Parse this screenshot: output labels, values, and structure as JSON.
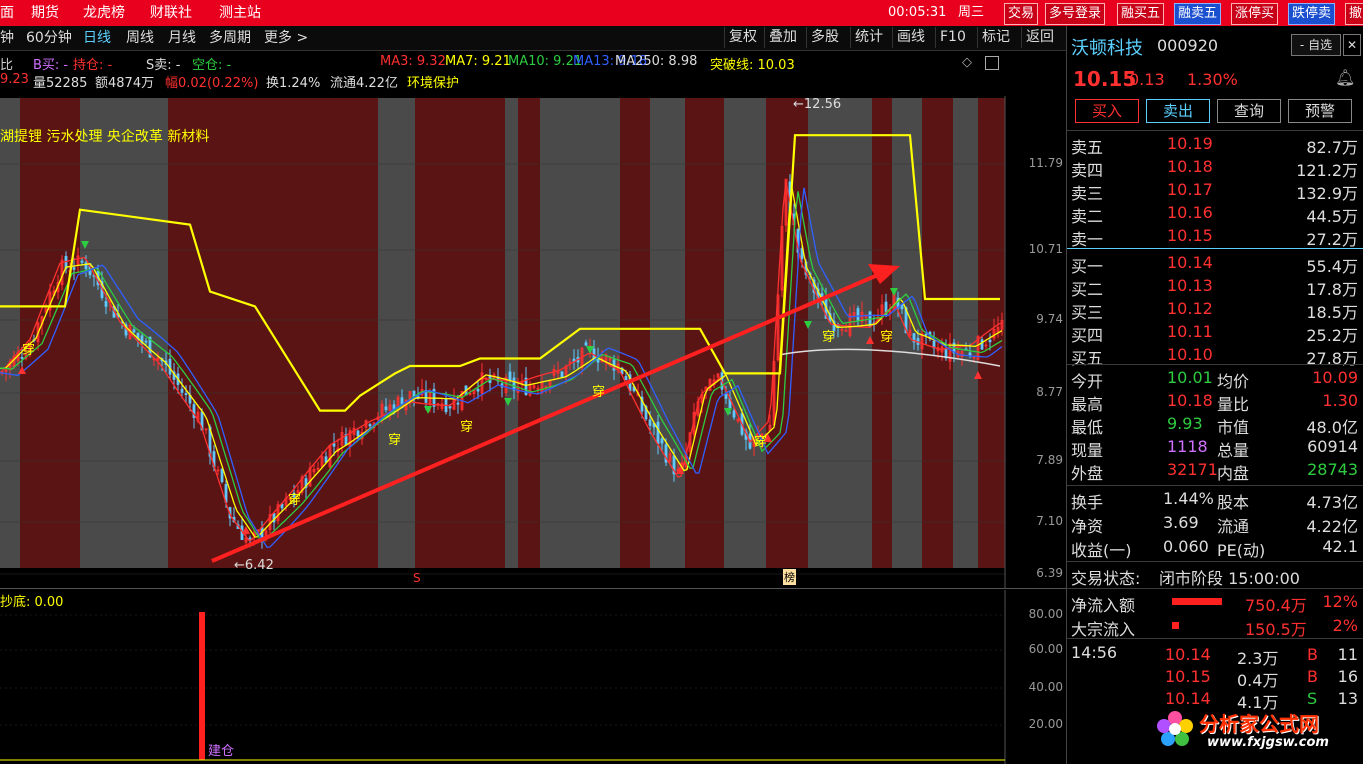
{
  "menu": {
    "items": [
      "面",
      "期货",
      "龙虎榜",
      "财联社",
      "测主站"
    ],
    "time": "00:05:31",
    "weekday": "周三",
    "buttons": [
      "交易",
      "多号登录",
      "融买五",
      "融卖五",
      "涨停买",
      "跌停卖",
      "撤"
    ]
  },
  "toolbar": {
    "timeframes": [
      "钟",
      "60分钟",
      "日线",
      "周线",
      "月线",
      "多周期",
      "更多 >"
    ],
    "active": "日线",
    "buttons": [
      "复权",
      "叠加",
      "多股",
      "统计",
      "画线",
      "F10",
      "标记",
      "返回"
    ]
  },
  "indicators": {
    "row1": [
      {
        "t": "比",
        "c": "#ccc"
      },
      {
        "t": "B买: -",
        "c": "#d070ff"
      },
      {
        "t": "持仓: -",
        "c": "#ff3030"
      },
      {
        "t": "S卖: -",
        "c": "#ddd"
      },
      {
        "t": "空仓: -",
        "c": "#2ecc40"
      },
      {
        "t": "MA3: 9.32",
        "c": "#ff3030"
      },
      {
        "t": "MA7: 9.21",
        "c": "#ffff00"
      },
      {
        "t": "MA10: 9.21",
        "c": "#2ecc40"
      },
      {
        "t": "MA13: 9.18",
        "c": "#3060ff"
      },
      {
        "t": "MA250: 8.98",
        "c": "#ddd"
      },
      {
        "t": "突破线: 10.03",
        "c": "#ffff00"
      }
    ],
    "row2": [
      {
        "t": "9.23",
        "c": "#ff3030"
      },
      {
        "t": "量52285",
        "c": "#ddd"
      },
      {
        "t": "额4874万",
        "c": "#ddd"
      },
      {
        "t": "幅0.02(0.22%)",
        "c": "#ff3030"
      },
      {
        "t": "换1.24%",
        "c": "#ddd"
      },
      {
        "t": "流通4.22亿",
        "c": "#ddd"
      },
      {
        "t": "环境保护",
        "c": "#ffff00"
      }
    ]
  },
  "concepts": "湖提锂 污水处理 央企改革 新材料",
  "annotations": {
    "high": "12.56",
    "low": "6.42",
    "cross": "穿",
    "marker_s": "S",
    "marker_bang": "榜",
    "build": "建仓",
    "sub_title": "抄底: 0.00"
  },
  "price_axis": [
    "11.79",
    "10.71",
    "9.74",
    "8.77",
    "7.89",
    "7.10",
    "6.39"
  ],
  "sub_axis": [
    "80.00",
    "60.00",
    "40.00",
    "20.00"
  ],
  "stock": {
    "name": "沃顿科技",
    "code": "000920",
    "price": "10.15",
    "change": "0.13",
    "pct": "1.30%",
    "watch_btn": "- 自选"
  },
  "actions": [
    "买入",
    "卖出",
    "查询",
    "预警"
  ],
  "orderbook": {
    "asks": [
      {
        "l": "卖五",
        "p": "10.19",
        "v": "82.7万"
      },
      {
        "l": "卖四",
        "p": "10.18",
        "v": "121.2万"
      },
      {
        "l": "卖三",
        "p": "10.17",
        "v": "132.9万"
      },
      {
        "l": "卖二",
        "p": "10.16",
        "v": "44.5万"
      },
      {
        "l": "卖一",
        "p": "10.15",
        "v": "27.2万"
      }
    ],
    "bids": [
      {
        "l": "买一",
        "p": "10.14",
        "v": "55.4万"
      },
      {
        "l": "买二",
        "p": "10.13",
        "v": "17.8万"
      },
      {
        "l": "买三",
        "p": "10.12",
        "v": "18.5万"
      },
      {
        "l": "买四",
        "p": "10.11",
        "v": "25.2万"
      },
      {
        "l": "买五",
        "p": "10.10",
        "v": "27.8万"
      }
    ]
  },
  "quote": [
    {
      "l1": "今开",
      "v1": "10.01",
      "c1": "#2ecc40",
      "l2": "均价",
      "v2": "10.09",
      "c2": "#ff3030"
    },
    {
      "l1": "最高",
      "v1": "10.18",
      "c1": "#ff3030",
      "l2": "量比",
      "v2": "1.30",
      "c2": "#ff3030"
    },
    {
      "l1": "最低",
      "v1": "9.93",
      "c1": "#2ecc40",
      "l2": "市值",
      "v2": "48.0亿",
      "c2": "#ddd"
    },
    {
      "l1": "现量",
      "v1": "1118",
      "c1": "#d070ff",
      "l2": "总量",
      "v2": "60914",
      "c2": "#ddd"
    },
    {
      "l1": "外盘",
      "v1": "32171",
      "c1": "#ff3030",
      "l2": "内盘",
      "v2": "28743",
      "c2": "#2ecc40"
    }
  ],
  "fund": [
    {
      "l1": "换手",
      "v1": "1.44%",
      "l2": "股本",
      "v2": "4.73亿"
    },
    {
      "l1": "净资",
      "v1": "3.69",
      "l2": "流通",
      "v2": "4.22亿"
    },
    {
      "l1": "收益(一)",
      "v1": "0.060",
      "l2": "PE(动)",
      "v2": "42.1"
    }
  ],
  "status": {
    "label": "交易状态:",
    "value": "闭市阶段 15:00:00"
  },
  "flow": [
    {
      "l": "净流入额",
      "v": "750.4万",
      "p": "12%",
      "bar": 0.9
    },
    {
      "l": "大宗流入",
      "v": "150.5万",
      "p": "2%",
      "bar": 0.12
    }
  ],
  "ticks": {
    "time": "14:56",
    "rows": [
      {
        "p": "10.14",
        "v": "2.3万",
        "s": "B",
        "n": "11"
      },
      {
        "p": "10.15",
        "v": "0.4万",
        "s": "B",
        "n": "16"
      },
      {
        "p": "10.14",
        "v": "4.1万",
        "s": "S",
        "n": "13"
      }
    ]
  },
  "watermark": {
    "cn": "分析家公式网",
    "url": "www.fxjgsw.com"
  },
  "colors": {
    "up": "#ff3030",
    "down": "#2ecc40",
    "accent": "#5bd0ff",
    "yellow": "#ffff00",
    "menu": "#e8001e"
  }
}
